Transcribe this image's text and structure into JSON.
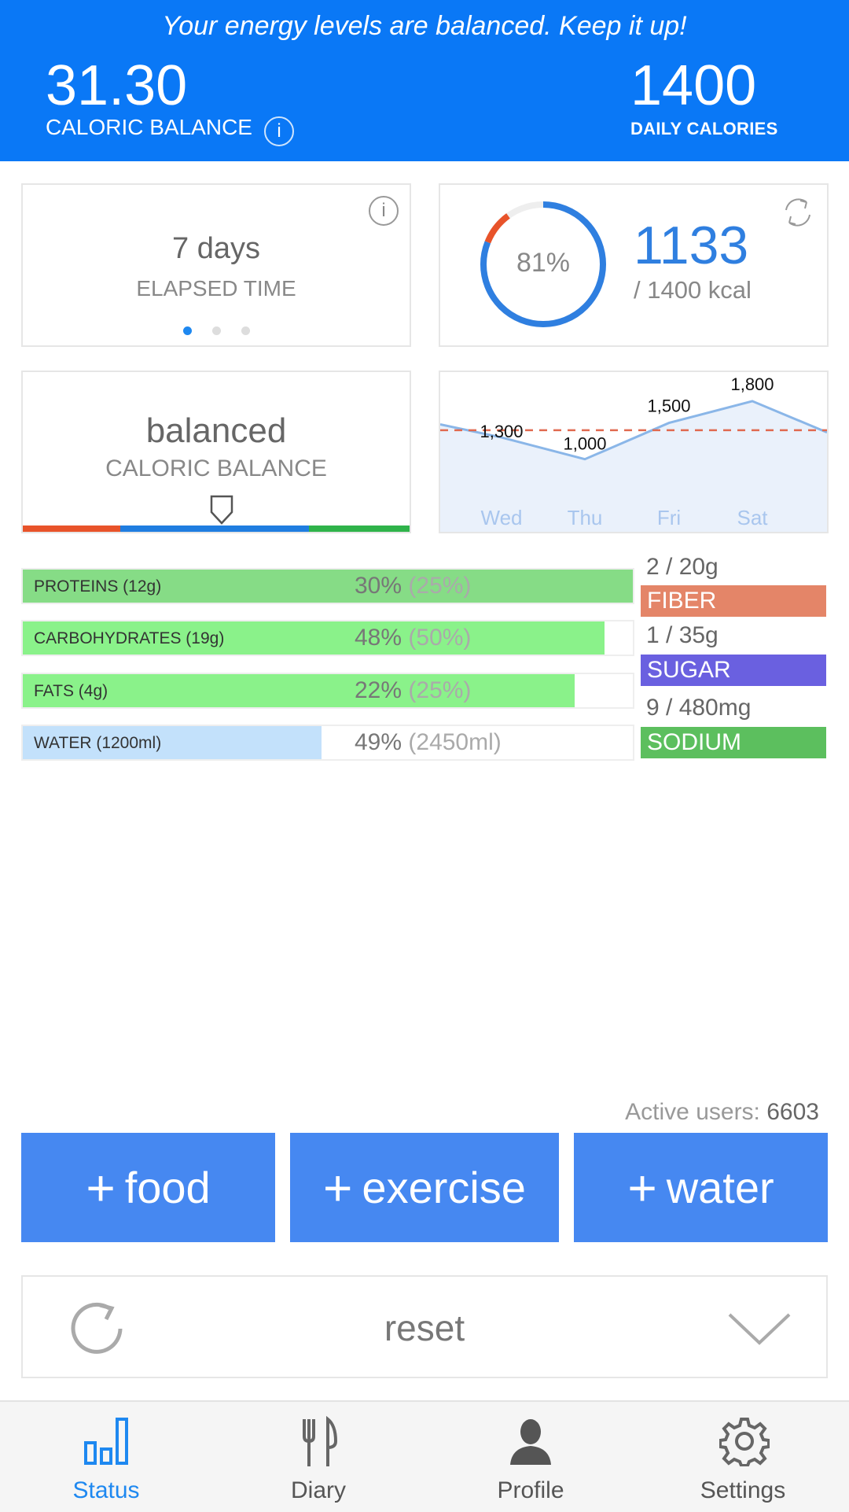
{
  "header": {
    "message": "Your energy levels are balanced. Keep it up!",
    "caloric_balance_value": "31.30",
    "caloric_balance_label": "CALORIC BALANCE",
    "info_glyph": "i",
    "daily_calories_value": "1400",
    "daily_calories_label": "DAILY CALORIES",
    "background_color": "#0a78f6"
  },
  "elapsed_card": {
    "value": "7 days",
    "label": "ELAPSED TIME",
    "info_glyph": "i",
    "pager_active_index": 0,
    "pager_count": 3
  },
  "progress_card": {
    "percent_text": "81%",
    "percent": 0.81,
    "consumed": "1133",
    "target_text": "/ 1400 kcal"
  },
  "balance_card": {
    "value": "balanced",
    "label": "CALORIC BALANCE",
    "segment_colors": [
      "#e8532a",
      "#1f7de0",
      "#2fb34a"
    ]
  },
  "chart_data": {
    "type": "line",
    "categories": [
      "Wed",
      "Thu",
      "Fri",
      "Sat"
    ],
    "series": [
      {
        "values": [
          1300,
          1000,
          1500,
          1800
        ]
      }
    ],
    "data_labels": [
      "1,300",
      "1,000",
      "1,500",
      "1,800"
    ],
    "target": 1400,
    "ylim": [
      0,
      2200
    ],
    "line_color": "#8ab6e8",
    "target_color": "#e06a50"
  },
  "macros": [
    {
      "label": "PROTEINS (12g)",
      "pct": "30%",
      "goal": "(25%)",
      "fill": 1.0,
      "color": "#86dc86"
    },
    {
      "label": "CARBOHYDRATES (19g)",
      "pct": "48%",
      "goal": "(50%)",
      "fill": 0.953,
      "color": "#8af28a"
    },
    {
      "label": "FATS (4g)",
      "pct": "22%",
      "goal": "(25%)",
      "fill": 0.904,
      "color": "#8af28a"
    },
    {
      "label": "WATER (1200ml)",
      "pct": "49%",
      "goal": "(2450ml)",
      "fill": 0.49,
      "color": "#c3e1fb"
    }
  ],
  "nutrients": [
    {
      "value": "2 / 20g",
      "label": "FIBER",
      "color": "#e48568"
    },
    {
      "value": "1 / 35g",
      "label": "SUGAR",
      "color": "#6a60e0"
    },
    {
      "value": "9 / 480mg",
      "label": "SODIUM",
      "color": "#5cbf5e"
    }
  ],
  "active_users": {
    "label": "Active users:",
    "count": "6603"
  },
  "actions": {
    "plus": "+",
    "food": "food",
    "exercise": "exercise",
    "water": "water",
    "button_color": "#4688f1"
  },
  "reset": {
    "label": "reset",
    "icon": "refresh-icon",
    "chevron": "chevron-down-icon"
  },
  "tabs": [
    {
      "label": "Status",
      "icon": "bar-chart-icon",
      "active": true
    },
    {
      "label": "Diary",
      "icon": "fork-knife-icon",
      "active": false
    },
    {
      "label": "Profile",
      "icon": "person-icon",
      "active": false
    },
    {
      "label": "Settings",
      "icon": "gear-icon",
      "active": false
    }
  ],
  "active_tab_color": "#1e88f0"
}
